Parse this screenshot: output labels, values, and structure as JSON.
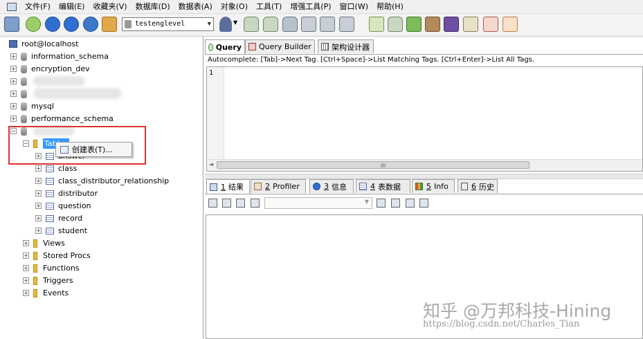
{
  "menu": [
    "文件(F)",
    "编辑(E)",
    "收藏夹(V)",
    "数据库(D)",
    "数据表(A)",
    "对象(O)",
    "工具(T)",
    "增强工具(P)",
    "窗口(W)",
    "帮助(H)"
  ],
  "toolbar": {
    "database_select": "testenglevel"
  },
  "tree": {
    "root": "root@localhost",
    "databases": [
      "information_schema",
      "encryption_dev",
      "mysql",
      "performance_schema"
    ],
    "tables_label": "Tables",
    "context_menu_item": "创建表(T)...",
    "tables": [
      "answer",
      "class",
      "class_distributor_relationship",
      "distributor",
      "question",
      "record",
      "student"
    ],
    "folders": [
      "Views",
      "Stored Procs",
      "Functions",
      "Triggers",
      "Events"
    ]
  },
  "editor": {
    "tabs": [
      "Query",
      "Query Builder",
      "架构设计器"
    ],
    "autocomplete_hint": "Autocomplete: [Tab]->Next Tag. [Ctrl+Space]->List Matching Tags. [Ctrl+Enter]->List All Tags.",
    "line_number": "1",
    "scroll_grip": "III"
  },
  "results": {
    "tabs": [
      {
        "num": "1",
        "label": "结果"
      },
      {
        "num": "2",
        "label": "Profiler"
      },
      {
        "num": "3",
        "label": "信息"
      },
      {
        "num": "4",
        "label": "表数据"
      },
      {
        "num": "5",
        "label": "Info"
      },
      {
        "num": "6",
        "label": "历史"
      }
    ]
  },
  "watermark": {
    "text": "知乎 @万邦科技-Hining",
    "url": "https://blog.csdn.net/Charles_Tian"
  },
  "colors": {
    "highlight_box": "#e03030",
    "selection": "#3399ff"
  }
}
